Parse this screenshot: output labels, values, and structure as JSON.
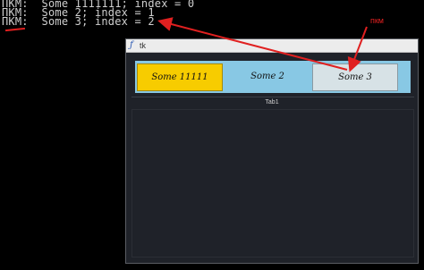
{
  "console": {
    "lines": [
      "ПКМ:  Some 1111111; index = 0",
      "ПКМ:  Some 2; index = 1",
      "ПКМ:  Some 3; index = 2"
    ]
  },
  "window": {
    "title": "tk",
    "tabs": [
      {
        "label": "Some 11111",
        "color": "#f7cc00"
      },
      {
        "label": "Some 2",
        "color": "#88c8e4"
      },
      {
        "label": "Some 3",
        "color": "#d7e2e6"
      }
    ],
    "content_label": "Tab1"
  },
  "annotation": {
    "label": "пкм",
    "color": "#e02020"
  }
}
